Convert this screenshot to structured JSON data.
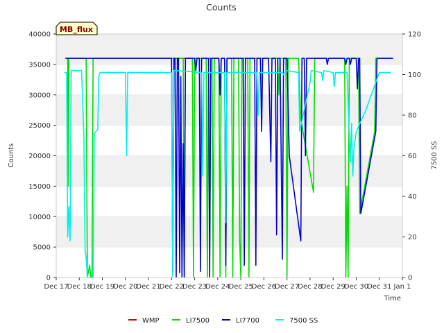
{
  "chart_data": {
    "type": "line",
    "title": "Counts",
    "xlabel": "Time",
    "ylabel": "Counts",
    "y2label": "7500 SS",
    "badge": "MB_flux",
    "x_range": [
      0,
      15
    ],
    "ylim": [
      0,
      40000
    ],
    "y2lim": [
      0,
      120
    ],
    "grid": "horizontal bands",
    "legend_position": "bottom",
    "x_ticks": [
      {
        "x": 0,
        "label": "Dec 17"
      },
      {
        "x": 1,
        "label": "Dec 18"
      },
      {
        "x": 2,
        "label": "Dec 19"
      },
      {
        "x": 3,
        "label": "Dec 20"
      },
      {
        "x": 4,
        "label": "Dec 21"
      },
      {
        "x": 5,
        "label": "Dec 22"
      },
      {
        "x": 6,
        "label": "Dec 23"
      },
      {
        "x": 7,
        "label": "Dec 24"
      },
      {
        "x": 8,
        "label": "Dec 25"
      },
      {
        "x": 9,
        "label": "Dec 26"
      },
      {
        "x": 10,
        "label": "Dec 27"
      },
      {
        "x": 11,
        "label": "Dec 28"
      },
      {
        "x": 12,
        "label": "Dec 29"
      },
      {
        "x": 13,
        "label": "Dec 30"
      },
      {
        "x": 14,
        "label": "Dec 31"
      },
      {
        "x": 15,
        "label": "Jan 1"
      }
    ],
    "y_ticks": [
      0,
      5000,
      10000,
      15000,
      20000,
      25000,
      30000,
      35000,
      40000
    ],
    "y2_ticks": [
      0,
      20,
      40,
      60,
      80,
      100,
      120
    ],
    "series": [
      {
        "name": "WMP",
        "color": "#dd0000",
        "axis": "left",
        "points": [
          [
            5.15,
            36000
          ],
          [
            5.9,
            36000
          ]
        ]
      },
      {
        "name": "LI7500",
        "color": "#00dd00",
        "axis": "left",
        "points": [
          [
            0.4,
            36000
          ],
          [
            0.5,
            36000
          ],
          [
            0.52,
            15000
          ],
          [
            0.55,
            36000
          ],
          [
            0.6,
            36000
          ],
          [
            1.3,
            36000
          ],
          [
            1.35,
            0
          ],
          [
            1.45,
            2000
          ],
          [
            1.5,
            0
          ],
          [
            1.55,
            0
          ],
          [
            1.6,
            36000
          ],
          [
            1.7,
            36000
          ],
          [
            5.5,
            36000
          ],
          [
            5.55,
            0
          ],
          [
            5.6,
            36000
          ],
          [
            5.9,
            36000
          ],
          [
            5.95,
            0
          ],
          [
            6.0,
            36000
          ],
          [
            6.5,
            36000
          ],
          [
            6.55,
            0
          ],
          [
            6.6,
            36000
          ],
          [
            6.75,
            36000
          ],
          [
            6.8,
            0
          ],
          [
            6.85,
            36000
          ],
          [
            7.05,
            36000
          ],
          [
            7.1,
            0
          ],
          [
            7.15,
            36000
          ],
          [
            7.3,
            36000
          ],
          [
            7.35,
            0
          ],
          [
            7.4,
            36000
          ],
          [
            7.6,
            36000
          ],
          [
            7.65,
            0
          ],
          [
            7.7,
            36000
          ],
          [
            7.9,
            36000
          ],
          [
            7.95,
            6000
          ],
          [
            8.0,
            0
          ],
          [
            8.05,
            36000
          ],
          [
            8.3,
            36000
          ],
          [
            8.35,
            0
          ],
          [
            8.4,
            36000
          ],
          [
            9.6,
            36000
          ],
          [
            9.65,
            30000
          ],
          [
            9.7,
            36000
          ],
          [
            9.95,
            36000
          ],
          [
            10.0,
            0
          ],
          [
            10.05,
            36000
          ],
          [
            10.5,
            36000
          ],
          [
            10.6,
            26000
          ],
          [
            11.15,
            14000
          ],
          [
            11.2,
            36000
          ],
          [
            12.5,
            36000
          ],
          [
            12.55,
            0
          ],
          [
            12.6,
            15000
          ],
          [
            12.65,
            0
          ],
          [
            12.7,
            36000
          ],
          [
            13.1,
            36000
          ],
          [
            13.15,
            10500
          ],
          [
            13.8,
            24000
          ],
          [
            13.85,
            36000
          ],
          [
            14.5,
            36000
          ]
        ]
      },
      {
        "name": "LI7700",
        "color": "#0000cc",
        "axis": "left",
        "points": [
          [
            0.4,
            36000
          ],
          [
            5.0,
            36000
          ],
          [
            5.05,
            800
          ],
          [
            5.1,
            36000
          ],
          [
            5.15,
            36000
          ],
          [
            5.2,
            0
          ],
          [
            5.25,
            36000
          ],
          [
            5.3,
            36000
          ],
          [
            5.35,
            800
          ],
          [
            5.4,
            33000
          ],
          [
            5.45,
            0
          ],
          [
            5.5,
            22000
          ],
          [
            5.55,
            0
          ],
          [
            5.6,
            36000
          ],
          [
            6.0,
            36000
          ],
          [
            6.05,
            34000
          ],
          [
            6.1,
            36000
          ],
          [
            6.2,
            36000
          ],
          [
            6.25,
            1000
          ],
          [
            6.3,
            36000
          ],
          [
            6.6,
            36000
          ],
          [
            6.65,
            0
          ],
          [
            6.7,
            36000
          ],
          [
            7.05,
            36000
          ],
          [
            7.1,
            30000
          ],
          [
            7.15,
            36000
          ],
          [
            7.3,
            36000
          ],
          [
            7.35,
            2000
          ],
          [
            7.4,
            36000
          ],
          [
            8.1,
            36000
          ],
          [
            8.15,
            2000
          ],
          [
            8.2,
            36000
          ],
          [
            8.6,
            36000
          ],
          [
            8.65,
            2000
          ],
          [
            8.7,
            36000
          ],
          [
            8.85,
            36000
          ],
          [
            8.9,
            24000
          ],
          [
            8.95,
            36000
          ],
          [
            9.2,
            36000
          ],
          [
            9.3,
            19000
          ],
          [
            9.35,
            36000
          ],
          [
            9.5,
            36000
          ],
          [
            9.55,
            7000
          ],
          [
            9.6,
            36000
          ],
          [
            9.7,
            36000
          ],
          [
            9.8,
            3000
          ],
          [
            9.85,
            36000
          ],
          [
            10.0,
            36000
          ],
          [
            10.1,
            20000
          ],
          [
            10.6,
            6000
          ],
          [
            10.65,
            36000
          ],
          [
            10.75,
            36000
          ],
          [
            10.8,
            20000
          ],
          [
            10.85,
            36000
          ],
          [
            11.7,
            36000
          ],
          [
            11.75,
            35000
          ],
          [
            11.8,
            36000
          ],
          [
            12.5,
            36000
          ],
          [
            12.55,
            35000
          ],
          [
            12.6,
            36000
          ],
          [
            12.7,
            36000
          ],
          [
            12.75,
            35000
          ],
          [
            12.8,
            36000
          ],
          [
            13.0,
            36000
          ],
          [
            13.05,
            31000
          ],
          [
            13.1,
            36000
          ],
          [
            13.15,
            36000
          ],
          [
            13.2,
            10500
          ],
          [
            13.85,
            24000
          ],
          [
            13.9,
            36000
          ],
          [
            14.6,
            36000
          ]
        ]
      },
      {
        "name": "7500 SS",
        "color": "#00eeee",
        "axis": "right",
        "points": [
          [
            0.35,
            101
          ],
          [
            0.45,
            101
          ],
          [
            0.5,
            20
          ],
          [
            0.55,
            35
          ],
          [
            0.6,
            18
          ],
          [
            0.65,
            102
          ],
          [
            1.1,
            102
          ],
          [
            1.2,
            70
          ],
          [
            1.25,
            14
          ],
          [
            1.3,
            10
          ],
          [
            1.35,
            0
          ],
          [
            1.6,
            0
          ],
          [
            1.65,
            71
          ],
          [
            1.8,
            73
          ],
          [
            1.85,
            99
          ],
          [
            1.9,
            101
          ],
          [
            3.0,
            101
          ],
          [
            3.05,
            60
          ],
          [
            3.1,
            101
          ],
          [
            5.0,
            101
          ],
          [
            5.05,
            0
          ],
          [
            5.1,
            102
          ],
          [
            5.2,
            102
          ],
          [
            6.3,
            101
          ],
          [
            6.35,
            50
          ],
          [
            6.4,
            101
          ],
          [
            7.3,
            101
          ],
          [
            7.35,
            27
          ],
          [
            7.4,
            101
          ],
          [
            8.7,
            101
          ],
          [
            8.75,
            80
          ],
          [
            8.8,
            101
          ],
          [
            9.8,
            101
          ],
          [
            9.85,
            100
          ],
          [
            10.0,
            102
          ],
          [
            10.5,
            101
          ],
          [
            10.55,
            72
          ],
          [
            11.0,
            96
          ],
          [
            11.05,
            102
          ],
          [
            11.5,
            101
          ],
          [
            11.55,
            97
          ],
          [
            11.6,
            102
          ],
          [
            12.0,
            101
          ],
          [
            12.05,
            94
          ],
          [
            12.1,
            101
          ],
          [
            12.6,
            101
          ],
          [
            12.75,
            57
          ],
          [
            12.8,
            76
          ],
          [
            12.85,
            50
          ],
          [
            12.9,
            63
          ],
          [
            13.0,
            72
          ],
          [
            13.4,
            82
          ],
          [
            14.0,
            101
          ],
          [
            14.5,
            101
          ]
        ]
      }
    ]
  }
}
